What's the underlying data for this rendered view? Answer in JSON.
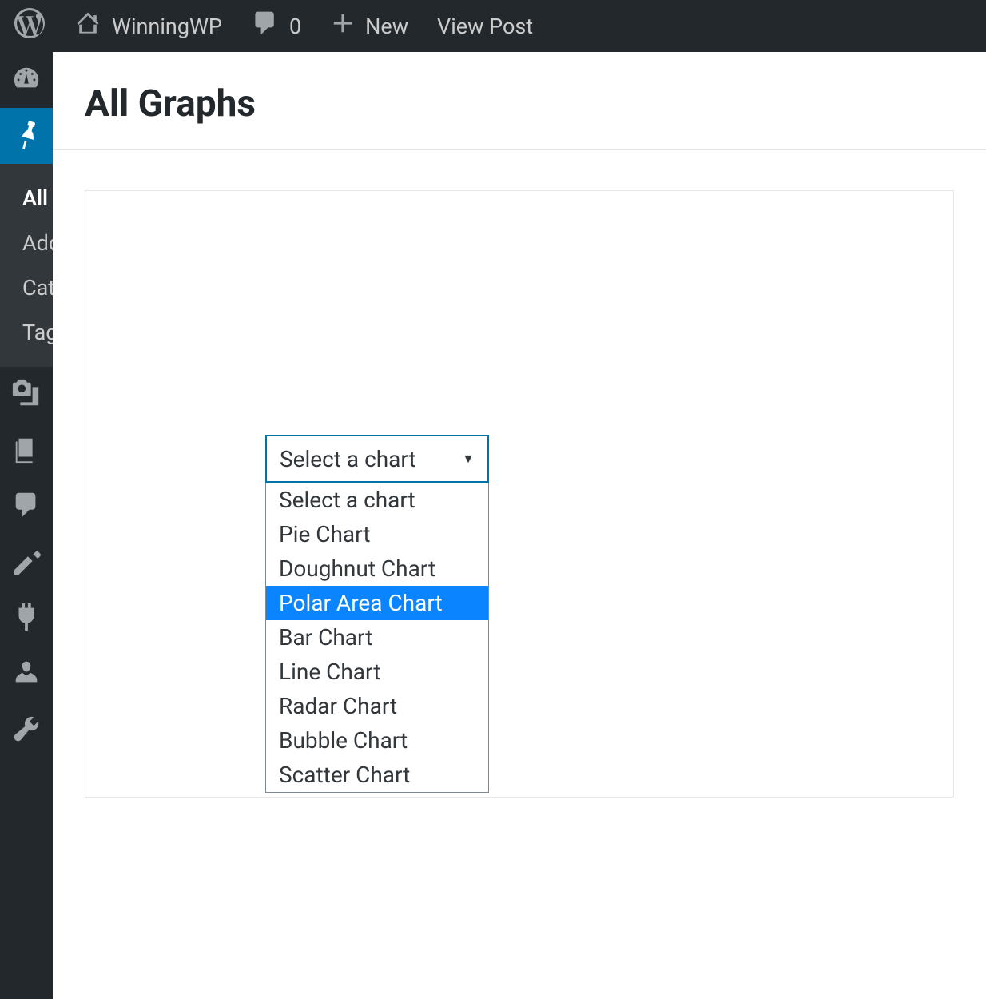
{
  "adminbar": {
    "site_name": "WinningWP",
    "comment_count": "0",
    "new_label": "New",
    "view_post_label": "View Post"
  },
  "sidebar": {
    "submenu": {
      "items": [
        {
          "label": "All",
          "active": true
        },
        {
          "label": "Add",
          "active": false
        },
        {
          "label": "Cat",
          "active": false
        },
        {
          "label": "Tag",
          "active": false
        }
      ]
    }
  },
  "page": {
    "title": "All Graphs"
  },
  "select": {
    "selected_label": "Select a chart",
    "options": [
      {
        "label": "Select a chart",
        "highlighted": false
      },
      {
        "label": "Pie Chart",
        "highlighted": false
      },
      {
        "label": "Doughnut Chart",
        "highlighted": false
      },
      {
        "label": "Polar Area Chart",
        "highlighted": true
      },
      {
        "label": "Bar Chart",
        "highlighted": false
      },
      {
        "label": "Line Chart",
        "highlighted": false
      },
      {
        "label": "Radar Chart",
        "highlighted": false
      },
      {
        "label": "Bubble Chart",
        "highlighted": false
      },
      {
        "label": "Scatter Chart",
        "highlighted": false
      }
    ]
  }
}
